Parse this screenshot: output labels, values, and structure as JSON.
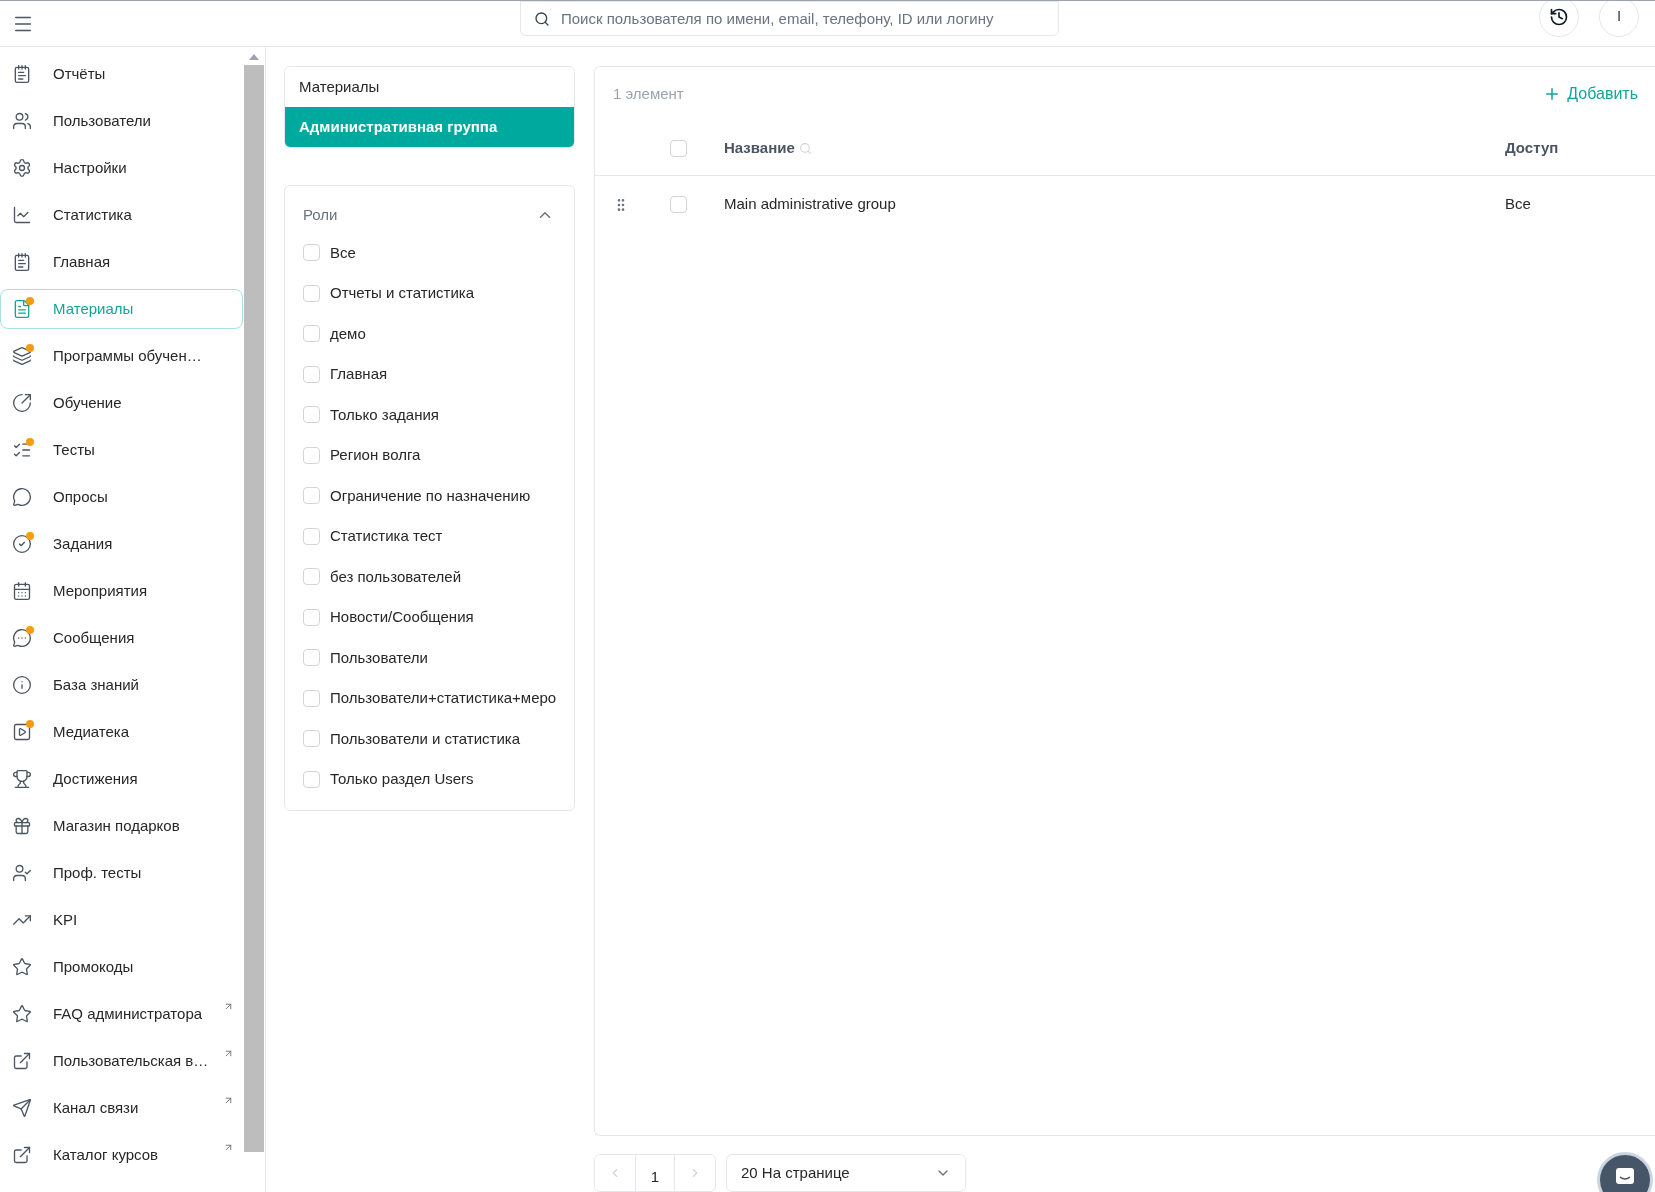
{
  "topbar": {
    "search": {
      "placeholder": "Поиск пользователя по имени, email, телефону, ID или логину"
    },
    "avatar": "I"
  },
  "sidebar": {
    "items": [
      {
        "label": "Отчёты",
        "selected": false,
        "dot": false,
        "external": false
      },
      {
        "label": "Пользователи",
        "selected": false,
        "dot": false,
        "external": false
      },
      {
        "label": "Настройки",
        "selected": false,
        "dot": false,
        "external": false
      },
      {
        "label": "Статистика",
        "selected": false,
        "dot": false,
        "external": false
      },
      {
        "label": "Главная",
        "selected": false,
        "dot": false,
        "external": false
      },
      {
        "label": "Материалы",
        "selected": true,
        "dot": true,
        "external": false
      },
      {
        "label": "Программы обучен…",
        "selected": false,
        "dot": true,
        "external": false
      },
      {
        "label": "Обучение",
        "selected": false,
        "dot": false,
        "external": false
      },
      {
        "label": "Тесты",
        "selected": false,
        "dot": true,
        "external": false
      },
      {
        "label": "Опросы",
        "selected": false,
        "dot": false,
        "external": false
      },
      {
        "label": "Задания",
        "selected": false,
        "dot": true,
        "external": false
      },
      {
        "label": "Мероприятия",
        "selected": false,
        "dot": false,
        "external": false
      },
      {
        "label": "Сообщения",
        "selected": false,
        "dot": true,
        "external": false
      },
      {
        "label": "База знаний",
        "selected": false,
        "dot": false,
        "external": false
      },
      {
        "label": "Медиатека",
        "selected": false,
        "dot": true,
        "external": false
      },
      {
        "label": "Достижения",
        "selected": false,
        "dot": false,
        "external": false
      },
      {
        "label": "Магазин подарков",
        "selected": false,
        "dot": false,
        "external": false
      },
      {
        "label": "Проф. тесты",
        "selected": false,
        "dot": false,
        "external": false
      },
      {
        "label": "KPI",
        "selected": false,
        "dot": false,
        "external": false
      },
      {
        "label": "Промокоды",
        "selected": false,
        "dot": false,
        "external": false
      },
      {
        "label": "FAQ администратора",
        "selected": false,
        "dot": false,
        "external": true
      },
      {
        "label": "Пользовательская в…",
        "selected": false,
        "dot": false,
        "external": true
      },
      {
        "label": "Канал связи",
        "selected": false,
        "dot": false,
        "external": true
      },
      {
        "label": "Каталог курсов",
        "selected": false,
        "dot": false,
        "external": true
      }
    ]
  },
  "groups": {
    "items": [
      {
        "label": "Материалы",
        "selected": false
      },
      {
        "label": "Административная группа",
        "selected": true
      }
    ]
  },
  "roles": {
    "title": "Роли",
    "expanded": true,
    "items": [
      {
        "label": "Все",
        "checked": false
      },
      {
        "label": "Отчеты и статистика",
        "checked": false
      },
      {
        "label": "демо",
        "checked": false
      },
      {
        "label": "Главная",
        "checked": false
      },
      {
        "label": "Только задания",
        "checked": false
      },
      {
        "label": "Регион волга",
        "checked": false
      },
      {
        "label": "Ограничение по назначению",
        "checked": false
      },
      {
        "label": "Статистика тест",
        "checked": false
      },
      {
        "label": "без пользователей",
        "checked": false
      },
      {
        "label": "Новости/Сообщения",
        "checked": false
      },
      {
        "label": "Пользователи",
        "checked": false
      },
      {
        "label": "Пользователи+статистика+меро",
        "checked": false
      },
      {
        "label": "Пользователи и статистика",
        "checked": false
      },
      {
        "label": "Только раздел Users",
        "checked": false
      }
    ]
  },
  "table": {
    "count": "1 элемент",
    "add_button": "Добавить",
    "all_checked": false,
    "columns": [
      "Название",
      "Доступ"
    ],
    "rows": [
      {
        "name": "Main administrative group",
        "access": "Все",
        "checked": false
      }
    ]
  },
  "pagination": {
    "page": "1",
    "per_page": "20 На странице"
  }
}
